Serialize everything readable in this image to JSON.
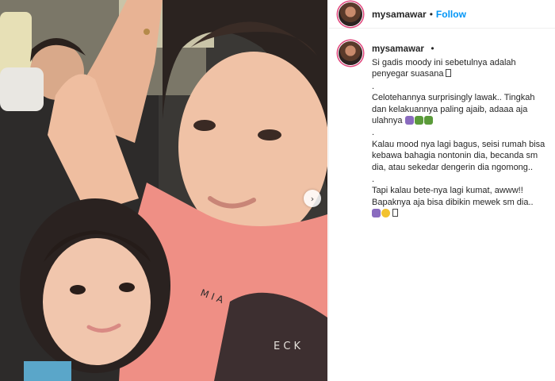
{
  "post": {
    "username": "mysamawar",
    "dot": "•",
    "follow_label": "Follow"
  },
  "photo": {
    "shirt_text_1": "M I A",
    "shirt_text_2": "E C K"
  },
  "icons": {
    "next": "chevron-right-icon",
    "emoji_colors": [
      "#8a6bbf",
      "#f2c230",
      "#5b9b3a"
    ]
  },
  "caption": {
    "line1": "Si gadis moody ini sebetulnya adalah penyegar suasana",
    "sep": ".",
    "line2": "Celotehannya surprisingly lawak.. Tingkah dan kelakuannya paling ajaib, adaaa aja ulahnya",
    "line3": "Kalau mood nya lagi bagus, seisi rumah bisa kebawa bahagia nontonin dia, becanda sm dia, atau sekedar dengerin dia ngomong..",
    "line4": "Tapi kalau bete-nya lagi kumat, awww!! Bapaknya aja bisa dibikin mewek sm dia.."
  }
}
